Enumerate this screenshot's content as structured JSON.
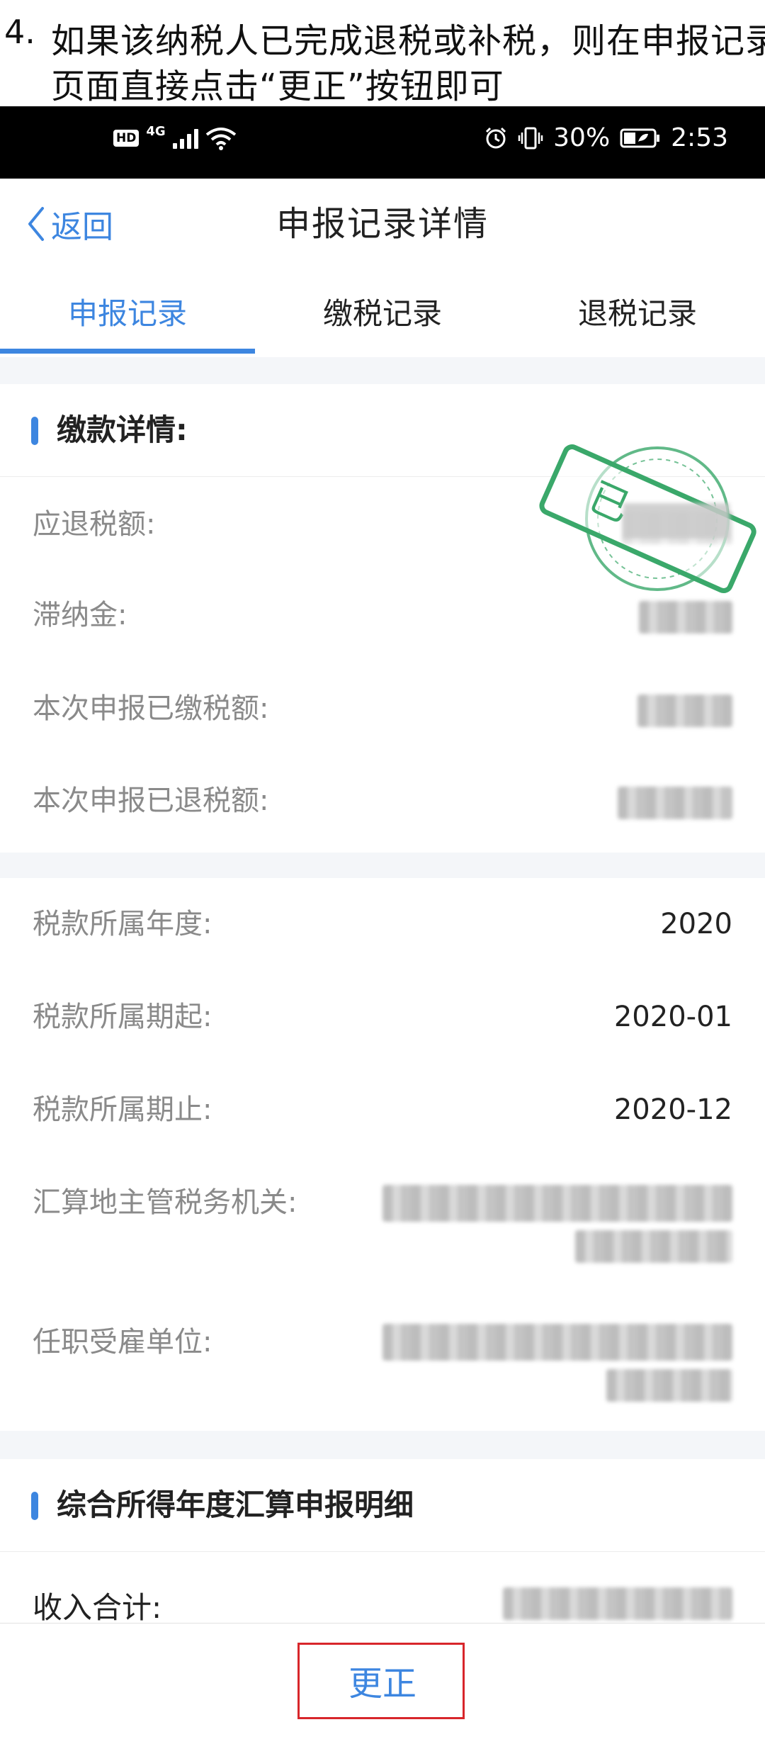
{
  "caption": {
    "number": "4.",
    "line1": "如果该纳税人已完成退税或补税，则在申报记录",
    "line2": "页面直接点击“更正”按钮即可"
  },
  "status_bar": {
    "hd": "HD",
    "network": "4G",
    "battery_percent": "30%",
    "time": "2:53"
  },
  "navbar": {
    "back_label": "返回",
    "title": "申报记录详情"
  },
  "tabs": [
    {
      "label": "申报记录",
      "active": true
    },
    {
      "label": "缴税记录",
      "active": false
    },
    {
      "label": "退税记录",
      "active": false
    }
  ],
  "payment_section": {
    "title": "缴款详情:",
    "stamp_text": "已",
    "rows": [
      {
        "label": "应退税额:"
      },
      {
        "label": "滞纳金:"
      },
      {
        "label": "本次申报已缴税额:"
      },
      {
        "label": "本次申报已退税额:"
      }
    ]
  },
  "period_section": {
    "rows": [
      {
        "label": "税款所属年度:",
        "value": "2020"
      },
      {
        "label": "税款所属期起:",
        "value": "2020-01"
      },
      {
        "label": "税款所属期止:",
        "value": "2020-12"
      },
      {
        "label": "汇算地主管税务机关:"
      },
      {
        "label": "任职受雇单位:"
      }
    ]
  },
  "annual_section": {
    "title": "综合所得年度汇算申报明细",
    "income_label": "收入合计:"
  },
  "bottom": {
    "correct_button": "更正"
  },
  "colors": {
    "accent": "#3d86e0",
    "highlight": "#d8262b",
    "stamp": "#3aa86a"
  }
}
